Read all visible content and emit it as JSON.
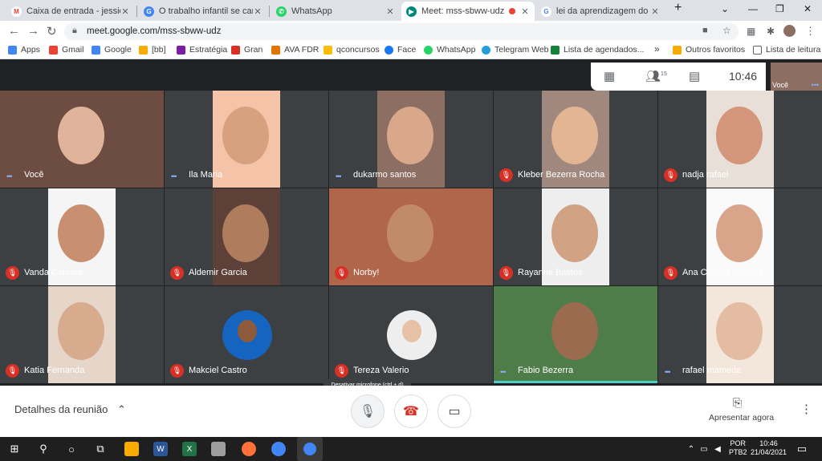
{
  "browser": {
    "tabs": [
      {
        "title": "Caixa de entrada - jessicasoa",
        "icon": "gmail-icon",
        "color": "#ea4335",
        "glyph": "M"
      },
      {
        "title": "O trabalho infantil se caracte",
        "icon": "web-icon",
        "color": "#4285f4",
        "glyph": "G"
      },
      {
        "title": "WhatsApp",
        "icon": "whatsapp-icon",
        "color": "#25d366",
        "glyph": "✆"
      },
      {
        "title": "Meet: mss-sbww-udz",
        "icon": "meet-icon",
        "color": "#00897b",
        "glyph": "▶"
      },
      {
        "title": "",
        "icon": "recording-icon",
        "color": "#ea4335",
        "glyph": ""
      },
      {
        "title": "lei da aprendizagem do adole",
        "icon": "google-icon",
        "color": "#4285f4",
        "glyph": "G"
      }
    ],
    "new_tab": "+",
    "url": "meet.google.com/mss-sbww-udz",
    "bookmarks": [
      {
        "label": "Apps",
        "color": "#4285f4"
      },
      {
        "label": "Gmail",
        "color": "#ea4335"
      },
      {
        "label": "Google",
        "color": "#4285f4"
      },
      {
        "label": "[bb]",
        "color": "#f9ab00"
      },
      {
        "label": "Estratégia",
        "color": "#7b1fa2"
      },
      {
        "label": "Gran",
        "color": "#d93025"
      },
      {
        "label": "AVA FDR",
        "color": "#e37400"
      },
      {
        "label": "qconcursos",
        "color": "#fbbc04"
      },
      {
        "label": "Face",
        "color": "#1877f2"
      },
      {
        "label": "WhatsApp",
        "color": "#25d366"
      },
      {
        "label": "Telegram Web",
        "color": "#229ed9"
      },
      {
        "label": "Lista de agendados...",
        "color": "#188038"
      }
    ],
    "more": "»",
    "other_favorites": "Outros favoritos",
    "reading_list": "Lista de leitura"
  },
  "meet": {
    "participant_count": "15",
    "time": "10:46",
    "self_thumb_label": "Você",
    "participants": [
      {
        "name": "Você",
        "muted": false,
        "bg": "#6d4c41",
        "skin": "#e0b49a"
      },
      {
        "name": "Ila Maria",
        "muted": false,
        "bg": "#f4c3a8",
        "skin": "#d7a07f"
      },
      {
        "name": "dukarmo santos",
        "muted": false,
        "bg": "#8d6e63",
        "skin": "#d9a88a"
      },
      {
        "name": "Kleber Bezerra Rocha",
        "muted": true,
        "bg": "#a1887f",
        "skin": "#e3b592"
      },
      {
        "name": "nadja rafael",
        "muted": true,
        "bg": "#e8e0d8",
        "skin": "#d4967a"
      },
      {
        "name": "Vanda Camara",
        "muted": true,
        "bg": "#f5f5f5",
        "skin": "#c88f70"
      },
      {
        "name": "Aldemir Garcia",
        "muted": true,
        "bg": "#5d4037",
        "skin": "#b07c5e"
      },
      {
        "name": "Norby!",
        "muted": true,
        "bg": "#b0664b",
        "skin": "#c18b6a"
      },
      {
        "name": "Rayanne Bastos",
        "muted": true,
        "bg": "#eeeeee",
        "skin": "#d1a284"
      },
      {
        "name": "Ana Claudia Moreira",
        "muted": true,
        "bg": "#fafafa",
        "skin": "#d8a48a"
      },
      {
        "name": "Katia Fernanda",
        "muted": true,
        "bg": "#e6d6c9",
        "skin": "#d8aa8e"
      },
      {
        "name": "Makciel Castro",
        "muted": true,
        "bg": "#3c4043",
        "skin": "#8d5a3b",
        "avatar": true,
        "avatar_bg": "#1565c0"
      },
      {
        "name": "Tereza Valerio",
        "muted": true,
        "bg": "#3c4043",
        "skin": "#e6c1a6",
        "avatar": true,
        "avatar_bg": "#eeeeee"
      },
      {
        "name": "Fabio Bezerra",
        "muted": false,
        "bg": "#4e7d4a",
        "skin": "#9a6b4f"
      },
      {
        "name": "rafael mamede",
        "muted": false,
        "bg": "#f3e6da",
        "skin": "#e3bca1"
      }
    ],
    "tooltip": "Desativar microfone (ctrl + d)",
    "details": "Detalhes da reunião",
    "present": "Apresentar agora"
  },
  "taskbar": {
    "lang": "POR",
    "layout": "PTB2",
    "time": "10:46",
    "date": "21/04/2021"
  }
}
